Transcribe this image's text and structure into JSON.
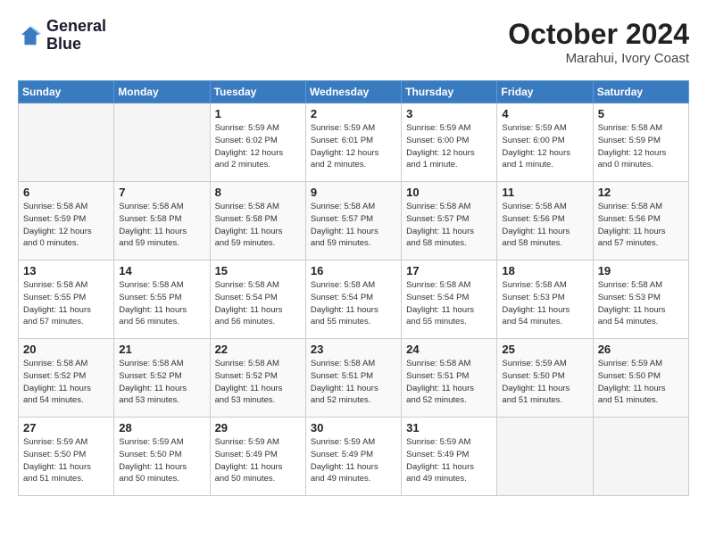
{
  "header": {
    "logo_line1": "General",
    "logo_line2": "Blue",
    "month": "October 2024",
    "location": "Marahui, Ivory Coast"
  },
  "weekdays": [
    "Sunday",
    "Monday",
    "Tuesday",
    "Wednesday",
    "Thursday",
    "Friday",
    "Saturday"
  ],
  "weeks": [
    [
      {
        "day": "",
        "detail": "",
        "empty": true
      },
      {
        "day": "",
        "detail": "",
        "empty": true
      },
      {
        "day": "1",
        "detail": "Sunrise: 5:59 AM\nSunset: 6:02 PM\nDaylight: 12 hours\nand 2 minutes.",
        "empty": false
      },
      {
        "day": "2",
        "detail": "Sunrise: 5:59 AM\nSunset: 6:01 PM\nDaylight: 12 hours\nand 2 minutes.",
        "empty": false
      },
      {
        "day": "3",
        "detail": "Sunrise: 5:59 AM\nSunset: 6:00 PM\nDaylight: 12 hours\nand 1 minute.",
        "empty": false
      },
      {
        "day": "4",
        "detail": "Sunrise: 5:59 AM\nSunset: 6:00 PM\nDaylight: 12 hours\nand 1 minute.",
        "empty": false
      },
      {
        "day": "5",
        "detail": "Sunrise: 5:58 AM\nSunset: 5:59 PM\nDaylight: 12 hours\nand 0 minutes.",
        "empty": false
      }
    ],
    [
      {
        "day": "6",
        "detail": "Sunrise: 5:58 AM\nSunset: 5:59 PM\nDaylight: 12 hours\nand 0 minutes.",
        "empty": false
      },
      {
        "day": "7",
        "detail": "Sunrise: 5:58 AM\nSunset: 5:58 PM\nDaylight: 11 hours\nand 59 minutes.",
        "empty": false
      },
      {
        "day": "8",
        "detail": "Sunrise: 5:58 AM\nSunset: 5:58 PM\nDaylight: 11 hours\nand 59 minutes.",
        "empty": false
      },
      {
        "day": "9",
        "detail": "Sunrise: 5:58 AM\nSunset: 5:57 PM\nDaylight: 11 hours\nand 59 minutes.",
        "empty": false
      },
      {
        "day": "10",
        "detail": "Sunrise: 5:58 AM\nSunset: 5:57 PM\nDaylight: 11 hours\nand 58 minutes.",
        "empty": false
      },
      {
        "day": "11",
        "detail": "Sunrise: 5:58 AM\nSunset: 5:56 PM\nDaylight: 11 hours\nand 58 minutes.",
        "empty": false
      },
      {
        "day": "12",
        "detail": "Sunrise: 5:58 AM\nSunset: 5:56 PM\nDaylight: 11 hours\nand 57 minutes.",
        "empty": false
      }
    ],
    [
      {
        "day": "13",
        "detail": "Sunrise: 5:58 AM\nSunset: 5:55 PM\nDaylight: 11 hours\nand 57 minutes.",
        "empty": false
      },
      {
        "day": "14",
        "detail": "Sunrise: 5:58 AM\nSunset: 5:55 PM\nDaylight: 11 hours\nand 56 minutes.",
        "empty": false
      },
      {
        "day": "15",
        "detail": "Sunrise: 5:58 AM\nSunset: 5:54 PM\nDaylight: 11 hours\nand 56 minutes.",
        "empty": false
      },
      {
        "day": "16",
        "detail": "Sunrise: 5:58 AM\nSunset: 5:54 PM\nDaylight: 11 hours\nand 55 minutes.",
        "empty": false
      },
      {
        "day": "17",
        "detail": "Sunrise: 5:58 AM\nSunset: 5:54 PM\nDaylight: 11 hours\nand 55 minutes.",
        "empty": false
      },
      {
        "day": "18",
        "detail": "Sunrise: 5:58 AM\nSunset: 5:53 PM\nDaylight: 11 hours\nand 54 minutes.",
        "empty": false
      },
      {
        "day": "19",
        "detail": "Sunrise: 5:58 AM\nSunset: 5:53 PM\nDaylight: 11 hours\nand 54 minutes.",
        "empty": false
      }
    ],
    [
      {
        "day": "20",
        "detail": "Sunrise: 5:58 AM\nSunset: 5:52 PM\nDaylight: 11 hours\nand 54 minutes.",
        "empty": false
      },
      {
        "day": "21",
        "detail": "Sunrise: 5:58 AM\nSunset: 5:52 PM\nDaylight: 11 hours\nand 53 minutes.",
        "empty": false
      },
      {
        "day": "22",
        "detail": "Sunrise: 5:58 AM\nSunset: 5:52 PM\nDaylight: 11 hours\nand 53 minutes.",
        "empty": false
      },
      {
        "day": "23",
        "detail": "Sunrise: 5:58 AM\nSunset: 5:51 PM\nDaylight: 11 hours\nand 52 minutes.",
        "empty": false
      },
      {
        "day": "24",
        "detail": "Sunrise: 5:58 AM\nSunset: 5:51 PM\nDaylight: 11 hours\nand 52 minutes.",
        "empty": false
      },
      {
        "day": "25",
        "detail": "Sunrise: 5:59 AM\nSunset: 5:50 PM\nDaylight: 11 hours\nand 51 minutes.",
        "empty": false
      },
      {
        "day": "26",
        "detail": "Sunrise: 5:59 AM\nSunset: 5:50 PM\nDaylight: 11 hours\nand 51 minutes.",
        "empty": false
      }
    ],
    [
      {
        "day": "27",
        "detail": "Sunrise: 5:59 AM\nSunset: 5:50 PM\nDaylight: 11 hours\nand 51 minutes.",
        "empty": false
      },
      {
        "day": "28",
        "detail": "Sunrise: 5:59 AM\nSunset: 5:50 PM\nDaylight: 11 hours\nand 50 minutes.",
        "empty": false
      },
      {
        "day": "29",
        "detail": "Sunrise: 5:59 AM\nSunset: 5:49 PM\nDaylight: 11 hours\nand 50 minutes.",
        "empty": false
      },
      {
        "day": "30",
        "detail": "Sunrise: 5:59 AM\nSunset: 5:49 PM\nDaylight: 11 hours\nand 49 minutes.",
        "empty": false
      },
      {
        "day": "31",
        "detail": "Sunrise: 5:59 AM\nSunset: 5:49 PM\nDaylight: 11 hours\nand 49 minutes.",
        "empty": false
      },
      {
        "day": "",
        "detail": "",
        "empty": true
      },
      {
        "day": "",
        "detail": "",
        "empty": true
      }
    ]
  ]
}
